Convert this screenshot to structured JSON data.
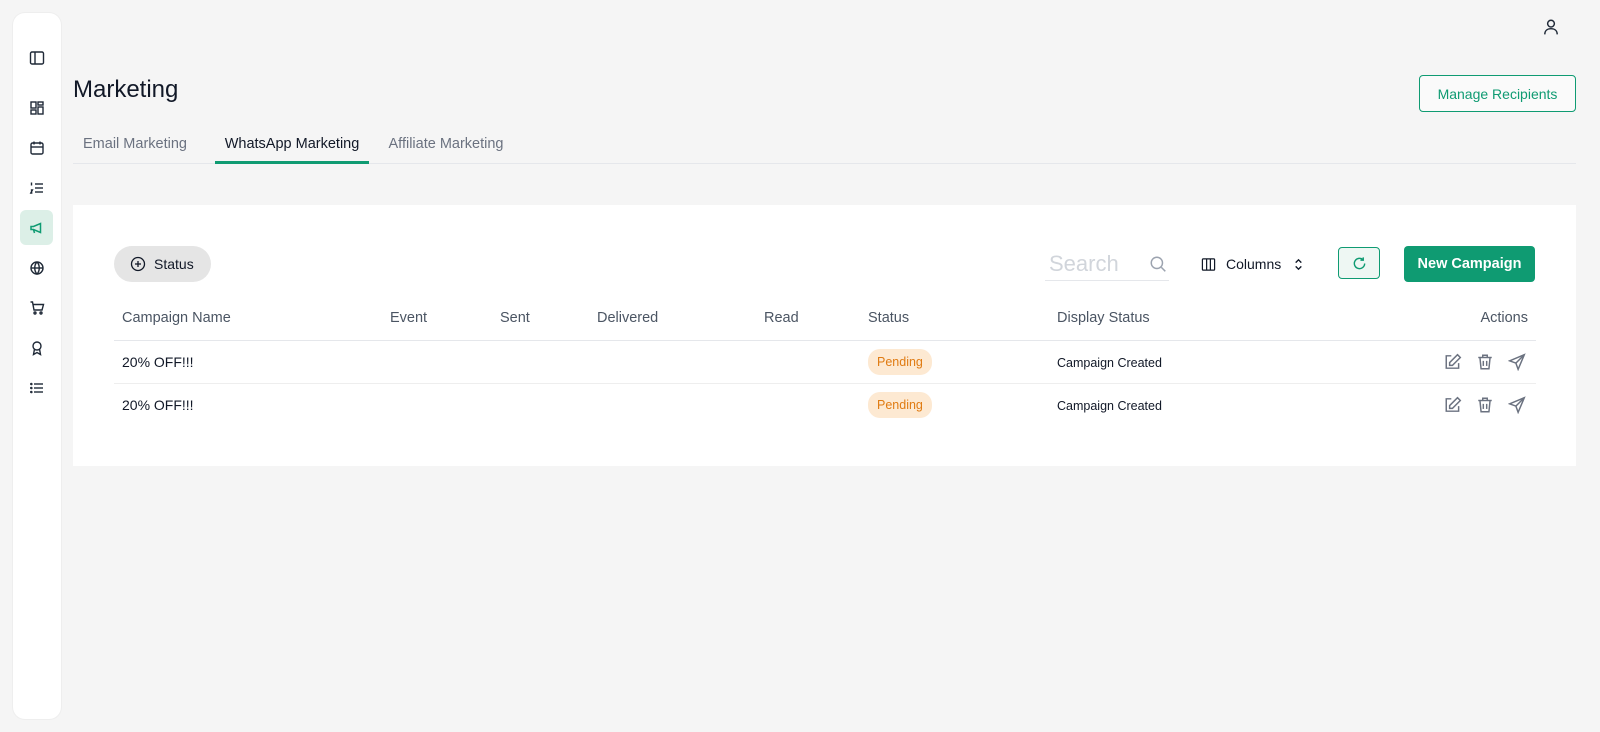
{
  "page": {
    "title": "Marketing",
    "manage_recipients_label": "Manage Recipients"
  },
  "sidebar": {
    "items": [
      {
        "icon": "panel-toggle-icon"
      },
      {
        "icon": "dashboard-icon"
      },
      {
        "icon": "calendar-icon"
      },
      {
        "icon": "ordered-list-icon"
      },
      {
        "icon": "megaphone-icon",
        "active": true
      },
      {
        "icon": "globe-icon"
      },
      {
        "icon": "cart-icon"
      },
      {
        "icon": "award-icon"
      },
      {
        "icon": "list-icon"
      }
    ]
  },
  "tabs": [
    {
      "label": "Email Marketing"
    },
    {
      "label": "WhatsApp Marketing",
      "active": true
    },
    {
      "label": "Affiliate Marketing"
    }
  ],
  "toolbar": {
    "status_filter_label": "Status",
    "search_placeholder": "Search",
    "columns_label": "Columns",
    "new_campaign_label": "New Campaign"
  },
  "table": {
    "headers": [
      "Campaign Name",
      "Event",
      "Sent",
      "Delivered",
      "Read",
      "Status",
      "Display Status",
      "Actions"
    ],
    "rows": [
      {
        "campaign_name": "20% OFF!!!",
        "event": "",
        "sent": "",
        "delivered": "",
        "read": "",
        "status": "Pending",
        "display_status": "Campaign Created"
      },
      {
        "campaign_name": "20% OFF!!!",
        "event": "",
        "sent": "",
        "delivered": "",
        "read": "",
        "status": "Pending",
        "display_status": "Campaign Created"
      }
    ]
  },
  "colors": {
    "accent": "#0f9b72",
    "pending_bg": "#fde9d2",
    "pending_text": "#e07b12",
    "background": "#f5f5f5"
  }
}
